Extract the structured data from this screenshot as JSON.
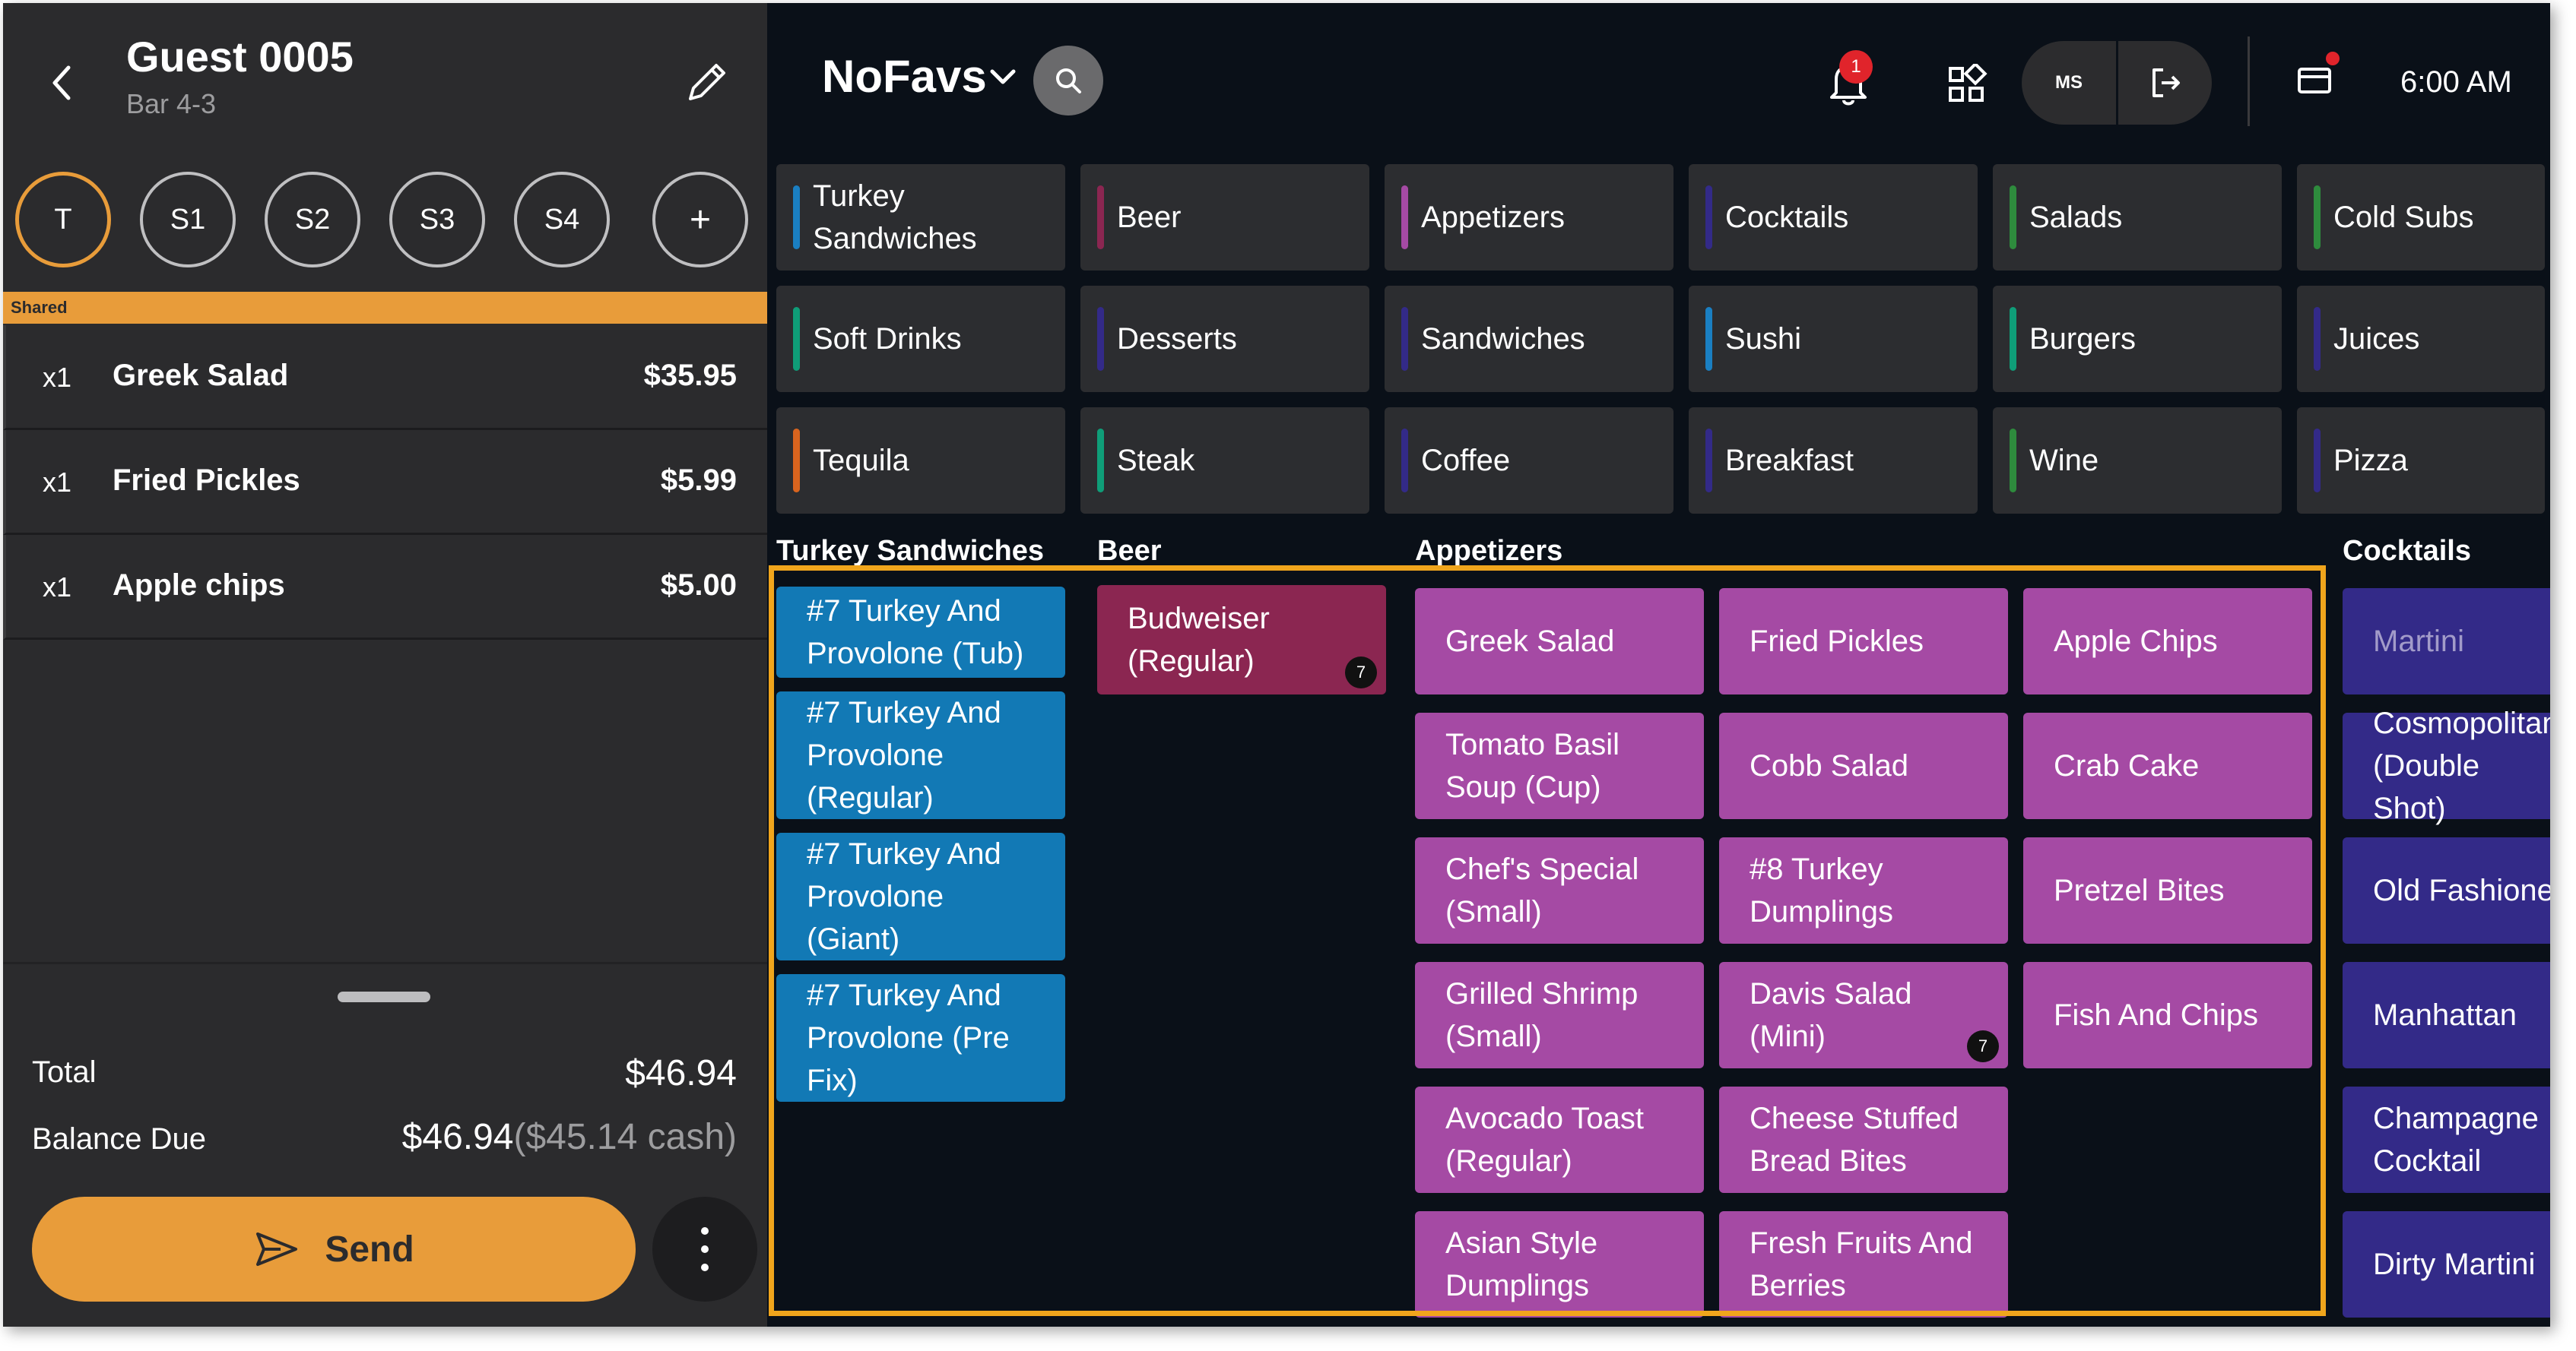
{
  "guest": {
    "title": "Guest 0005",
    "subtitle": "Bar 4-3"
  },
  "seats": [
    {
      "label": "T",
      "active": true
    },
    {
      "label": "S1"
    },
    {
      "label": "S2"
    },
    {
      "label": "S3"
    },
    {
      "label": "S4"
    }
  ],
  "shared_label": "Shared",
  "order_items": [
    {
      "qty": "x1",
      "name": "Greek Salad",
      "price": "$35.95"
    },
    {
      "qty": "x1",
      "name": "Fried Pickles",
      "price": "$5.99"
    },
    {
      "qty": "x1",
      "name": "Apple chips",
      "price": "$5.00"
    }
  ],
  "totals": {
    "total_label": "Total",
    "total_value": "$46.94",
    "balance_label": "Balance Due",
    "balance_value": "$46.94",
    "balance_cash": "($45.14 cash)"
  },
  "send_label": "Send",
  "header": {
    "brand": "NoFavs",
    "notification_count": "1",
    "user_initials": "MS",
    "time": "6:00 AM"
  },
  "categories": [
    {
      "label": "Turkey Sandwiches",
      "color": "#1a7fc2"
    },
    {
      "label": "Beer",
      "color": "#8b2651"
    },
    {
      "label": "Appetizers",
      "color": "#a54aa4"
    },
    {
      "label": "Cocktails",
      "color": "#332a88"
    },
    {
      "label": "Salads",
      "color": "#2e8b3d"
    },
    {
      "label": "Cold Subs",
      "color": "#2e8b3d"
    },
    {
      "label": "Soft Drinks",
      "color": "#0f9d78"
    },
    {
      "label": "Desserts",
      "color": "#332a88"
    },
    {
      "label": "Sandwiches",
      "color": "#332a88"
    },
    {
      "label": "Sushi",
      "color": "#1a7fc2"
    },
    {
      "label": "Burgers",
      "color": "#0f9d78"
    },
    {
      "label": "Juices",
      "color": "#332a88"
    },
    {
      "label": "Tequila",
      "color": "#d9641e"
    },
    {
      "label": "Steak",
      "color": "#0f9d78"
    },
    {
      "label": "Coffee",
      "color": "#332a88"
    },
    {
      "label": "Breakfast",
      "color": "#332a88"
    },
    {
      "label": "Wine",
      "color": "#2e8b3d"
    },
    {
      "label": "Pizza",
      "color": "#332a88"
    }
  ],
  "sections": {
    "turkey": {
      "title": "Turkey Sandwiches",
      "items": [
        {
          "label": "#7 Turkey And Provolone (Tub)"
        },
        {
          "label": "#7 Turkey And Provolone (Regular)"
        },
        {
          "label": "#7 Turkey And Provolone (Giant)"
        },
        {
          "label": "#7 Turkey And Provolone (Pre Fix)"
        }
      ]
    },
    "beer": {
      "title": "Beer",
      "items": [
        {
          "label": "Budweiser (Regular)",
          "badge": "7"
        }
      ]
    },
    "appetizers": {
      "title": "Appetizers",
      "items": [
        {
          "label": "Greek Salad"
        },
        {
          "label": "Fried Pickles"
        },
        {
          "label": "Apple Chips"
        },
        {
          "label": "Tomato Basil Soup (Cup)"
        },
        {
          "label": "Cobb Salad"
        },
        {
          "label": "Crab Cake"
        },
        {
          "label": "Chef's Special (Small)"
        },
        {
          "label": "#8 Turkey Dumplings"
        },
        {
          "label": "Pretzel Bites"
        },
        {
          "label": "Grilled Shrimp (Small)"
        },
        {
          "label": "Davis Salad (Mini)",
          "badge": "7"
        },
        {
          "label": "Fish And Chips"
        },
        {
          "label": "Avocado Toast (Regular)"
        },
        {
          "label": "Cheese Stuffed Bread Bites"
        },
        {
          "label": "Asian Style Dumplings"
        },
        {
          "label": "Fresh Fruits And Berries"
        }
      ]
    },
    "cocktails": {
      "title": "Cocktails",
      "items": [
        {
          "label": "Martini",
          "dim": true
        },
        {
          "label": "Cosmopolitan (Double Shot)"
        },
        {
          "label": "Old Fashioned"
        },
        {
          "label": "Manhattan"
        },
        {
          "label": "Champagne Cocktail"
        },
        {
          "label": "Dirty Martini"
        }
      ]
    }
  }
}
